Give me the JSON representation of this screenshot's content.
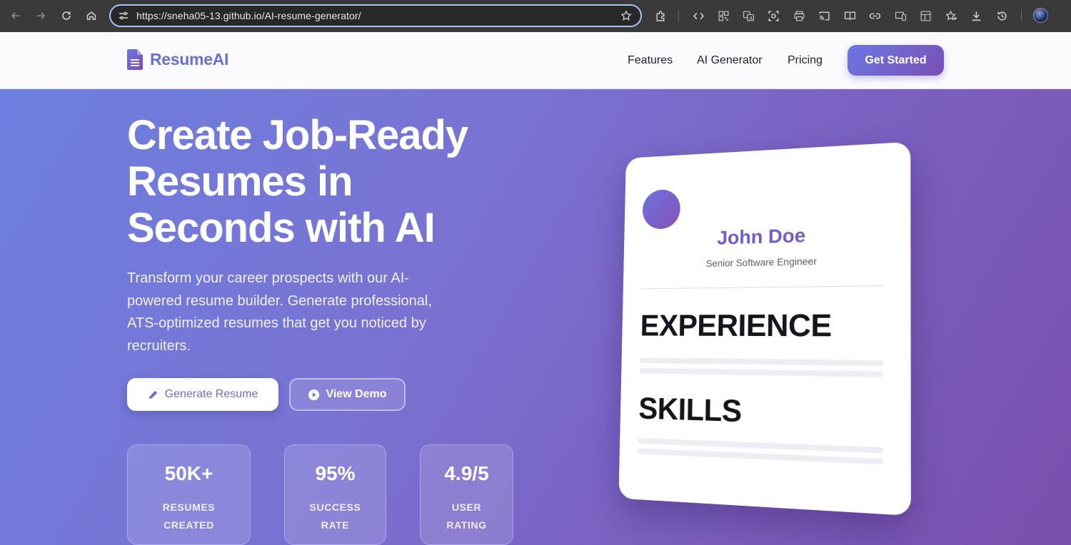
{
  "browser": {
    "url": "https://sneha05-13.github.io/AI-resume-generator/"
  },
  "header": {
    "logo_text": "ResumeAI",
    "nav": [
      "Features",
      "AI Generator",
      "Pricing"
    ],
    "cta_label": "Get Started"
  },
  "hero": {
    "title": "Create Job-Ready Resumes in Seconds with AI",
    "subtitle": "Transform your career prospects with our AI-powered resume builder. Generate professional, ATS-optimized resumes that get you noticed by recruiters.",
    "primary_button": "Generate Resume",
    "secondary_button": "View Demo",
    "stats": [
      {
        "value": "50K+",
        "label_line1": "RESUMES",
        "label_line2": "CREATED"
      },
      {
        "value": "95%",
        "label_line1": "SUCCESS",
        "label_line2": "RATE"
      },
      {
        "value": "4.9/5",
        "label_line1": "USER",
        "label_line2": "RATING"
      }
    ]
  },
  "resume_preview": {
    "name": "John Doe",
    "role": "Senior Software Engineer",
    "section1": "EXPERIENCE",
    "section2": "SKILLS"
  },
  "colors": {
    "brand": "#6a6fd6",
    "hero_gradient_start": "#6c7fe0",
    "hero_gradient_end": "#7a4fad"
  }
}
